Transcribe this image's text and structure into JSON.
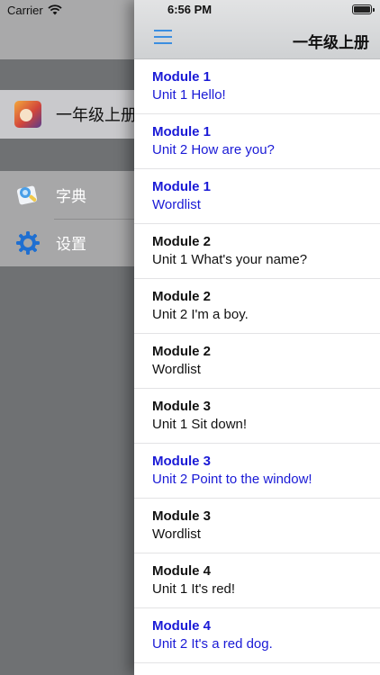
{
  "status_bar": {
    "carrier": "Carrier",
    "time": "6:56 PM",
    "battery_level": 1.0
  },
  "menu": {
    "book": {
      "label": "一年级上册",
      "icon": "book-cover-icon"
    },
    "items": [
      {
        "label": "字典",
        "icon": "dictionary-icon"
      },
      {
        "label": "设置",
        "icon": "gear-icon"
      }
    ]
  },
  "navbar": {
    "title": "一年级上册",
    "menu_icon": "hamburger-icon"
  },
  "colors": {
    "link_blue": "#1a1ad6",
    "accent": "#3b8ee0"
  },
  "lessons": [
    {
      "module": "Module 1",
      "unit": "Unit 1 Hello!",
      "highlight": true
    },
    {
      "module": "Module 1",
      "unit": "Unit 2 How are you?",
      "highlight": true
    },
    {
      "module": "Module 1",
      "unit": "Wordlist",
      "highlight": true
    },
    {
      "module": "Module 2",
      "unit": "Unit 1 What's your name?",
      "highlight": false
    },
    {
      "module": "Module 2",
      "unit": "Unit 2 I'm a boy.",
      "highlight": false
    },
    {
      "module": "Module 2",
      "unit": "Wordlist",
      "highlight": false
    },
    {
      "module": "Module 3",
      "unit": "Unit 1 Sit down!",
      "highlight": false
    },
    {
      "module": "Module 3",
      "unit": "Unit 2 Point to the window!",
      "highlight": true
    },
    {
      "module": "Module 3",
      "unit": "Wordlist",
      "highlight": false
    },
    {
      "module": "Module 4",
      "unit": "Unit 1 It's red!",
      "highlight": false
    },
    {
      "module": "Module 4",
      "unit": "Unit 2 It's a red dog.",
      "highlight": true
    }
  ]
}
